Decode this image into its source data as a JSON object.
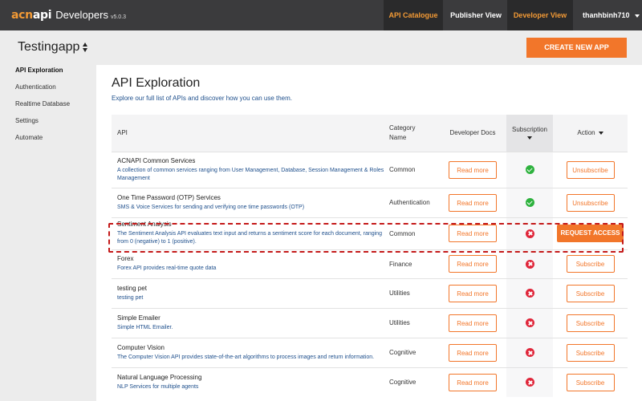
{
  "topnav": {
    "logo_part1": "acn",
    "logo_part2": "api",
    "logo_suffix": "Developers",
    "version": "v5.0.3",
    "catalogue": "API Catalogue",
    "publisher": "Publisher View",
    "developer": "Developer View",
    "user": "thanhbinh710"
  },
  "app": {
    "title": "Testingapp",
    "create_button": "CREATE NEW APP"
  },
  "sidebar": {
    "items": [
      {
        "label": "API Exploration"
      },
      {
        "label": "Authentication"
      },
      {
        "label": "Realtime Database"
      },
      {
        "label": "Settings"
      },
      {
        "label": "Automate"
      }
    ]
  },
  "main": {
    "title": "API Exploration",
    "subtitle": "Explore our full list of APIs and discover how you can use them."
  },
  "table": {
    "headers": {
      "api": "API",
      "category": "Category Name",
      "docs": "Developer Docs",
      "subscription": "Subscription",
      "action": "Action"
    },
    "rows": [
      {
        "name": "ACNAPI Common Services",
        "desc": "A collection of common services ranging from User Management, Database, Session Management & Roles Management",
        "category": "Common",
        "docs": "Read more",
        "subscribed": true,
        "action": "Unsubscribe",
        "action_style": "outline"
      },
      {
        "name": "One Time Password (OTP) Services",
        "desc": "SMS & Voice Services for sending and verifying one time passwords (OTP)",
        "category": "Authentication",
        "docs": "Read more",
        "subscribed": true,
        "action": "Unsubscribe",
        "action_style": "outline"
      },
      {
        "name": "Sentiment Analysis",
        "desc": "The Sentiment Analysis API evaluates text input and returns a sentiment score for each document, ranging from 0 (negative) to 1 (positive).",
        "category": "Common",
        "docs": "Read more",
        "subscribed": false,
        "action": "REQUEST ACCESS",
        "action_style": "solid"
      },
      {
        "name": "Forex",
        "desc": "Forex API provides real-time quote data",
        "category": "Finance",
        "docs": "Read more",
        "subscribed": false,
        "action": "Subscribe",
        "action_style": "outline"
      },
      {
        "name": "testing pet",
        "desc": "testing pet",
        "category": "Utilities",
        "docs": "Read more",
        "subscribed": false,
        "action": "Subscribe",
        "action_style": "outline"
      },
      {
        "name": "Simple Emailer",
        "desc": "Simple HTML Emailer.",
        "category": "Utilities",
        "docs": "Read more",
        "subscribed": false,
        "action": "Subscribe",
        "action_style": "outline"
      },
      {
        "name": "Computer Vision",
        "desc": "The Computer Vision API provides state-of-the-art algorithms to process images and return information.",
        "category": "Cognitive",
        "docs": "Read more",
        "subscribed": false,
        "action": "Subscribe",
        "action_style": "outline"
      },
      {
        "name": "Natural Language Processing",
        "desc": "NLP Services for multiple agents",
        "category": "Cognitive",
        "docs": "Read more",
        "subscribed": false,
        "action": "Subscribe",
        "action_style": "outline"
      }
    ]
  },
  "colors": {
    "accent": "#f2762a",
    "nav_bg": "#3b3b3d",
    "link_blue": "#1e4f8c",
    "ok_green": "#2eb23e",
    "error_red": "#e0263a"
  }
}
